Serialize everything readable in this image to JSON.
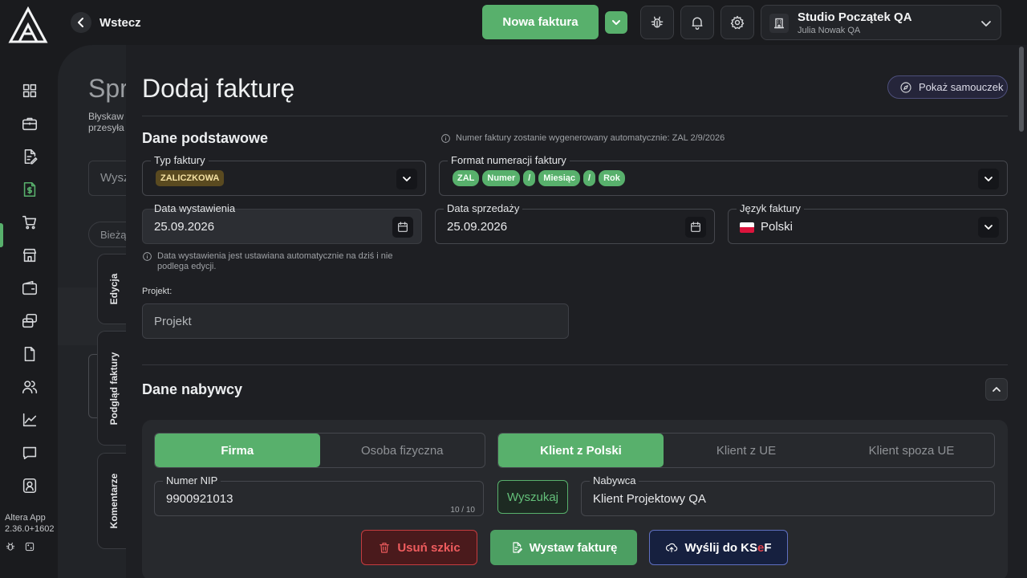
{
  "header": {
    "back_label": "Wstecz",
    "new_invoice_label": "Nowa faktura",
    "company_name": "Studio Początek QA",
    "user_name": "Julia Nowak QA"
  },
  "sidebar": {
    "items": [
      "dashboard",
      "portfolio",
      "documents",
      "invoices",
      "cart",
      "store",
      "wallet",
      "transfers",
      "file",
      "users",
      "charts",
      "messages",
      "profile"
    ],
    "active": "invoices",
    "version_line1": "Altera App",
    "version_line2": "2.36.0+1602"
  },
  "background_page": {
    "title": "Spr",
    "subtitle": "Błyskaw\nprzesyła",
    "search_placeholder": "Wysz",
    "filter_label": "Bieżą"
  },
  "side_tabs": [
    "Edycja",
    "Podgląd faktury",
    "Komentarze"
  ],
  "drawer": {
    "title": "Dodaj fakturę",
    "tutorial_label": "Pokaż samouczek",
    "basic_section": "Dane podstawowe",
    "auto_number_info": "Numer faktury zostanie wygenerowany automatycznie: ZAL 2/9/2026",
    "invoice_type_label": "Typ faktury",
    "invoice_type_value": "ZALICZKOWA",
    "numbering_label": "Format numeracji faktury",
    "numbering_chips": [
      "ZAL",
      "Numer",
      "/",
      "Miesiąc",
      "/",
      "Rok"
    ],
    "issue_date_label": "Data wystawienia",
    "issue_date_value": "25.09.2026",
    "sale_date_label": "Data sprzedaży",
    "sale_date_value": "25.09.2026",
    "language_label": "Język faktury",
    "language_value": "Polski",
    "issue_date_info": "Data wystawienia jest ustawiana automatycznie na dziś i nie podlega edycji.",
    "project_label": "Projekt:",
    "project_placeholder": "Projekt",
    "buyer_section": "Dane nabywcy",
    "entity_options": [
      "Firma",
      "Osoba fizyczna"
    ],
    "entity_selected": "Firma",
    "origin_options": [
      "Klient z Polski",
      "Klient z UE",
      "Klient spoza UE"
    ],
    "origin_selected": "Klient z Polski",
    "nip_label": "Numer NIP",
    "nip_value": "9900921013",
    "nip_count": "10 / 10",
    "search_label": "Wyszukaj",
    "buyer_label": "Nabywca",
    "buyer_value": "Klient Projektowy QA"
  },
  "actions": {
    "delete_label": "Usuń szkic",
    "issue_label": "Wystaw fakturę",
    "ksef_prefix": "Wyślij do KS",
    "ksef_mark": "e",
    "ksef_suffix": "F"
  },
  "colors": {
    "accent_green": "#58b06c",
    "danger_red": "#ef5c5e",
    "ksef_navy": "#16203f",
    "badge_gold": "#5a4a20"
  }
}
